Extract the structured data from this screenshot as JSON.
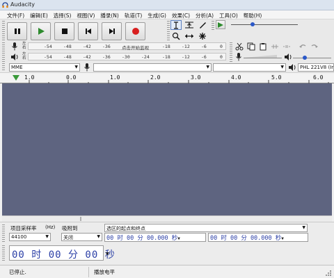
{
  "window": {
    "title": "Audacity"
  },
  "menu": [
    "文件(F)",
    "编辑(E)",
    "选择(S)",
    "视图(V)",
    "播录(N)",
    "轨道(T)",
    "生成(G)",
    "效果(C)",
    "分析(A)",
    "工具(O)",
    "帮助(H)"
  ],
  "transport": {
    "buttons": [
      "pause-icon",
      "play-icon",
      "stop-icon",
      "skip-start-icon",
      "skip-end-icon",
      "record-icon"
    ],
    "colors": {
      "play": "#2e8b2e",
      "record": "#d81f1f"
    }
  },
  "tools": [
    "selection-tool-icon",
    "envelope-tool-icon",
    "draw-tool-icon",
    "zoom-tool-icon",
    "timeshift-tool-icon",
    "multi-tool-icon"
  ],
  "record_meter": {
    "l_label": "左",
    "r_label": "右",
    "ticks": [
      "-54",
      "-48",
      "-42",
      "-36",
      "点击开始监视",
      "-18",
      "-12",
      "-6",
      "0"
    ]
  },
  "play_meter": {
    "l_label": "左",
    "r_label": "右",
    "ticks": [
      "-54",
      "-48",
      "-42",
      "-36",
      "-30",
      "-24",
      "-18",
      "-12",
      "-6",
      "0"
    ]
  },
  "devices": {
    "host": "MME",
    "recording": "",
    "channels": "",
    "playback": "PHL 221V8 (Int"
  },
  "ruler": {
    "labels": [
      "1.0",
      "0.0",
      "1.0",
      "2.0",
      "3.0",
      "4.0",
      "5.0",
      "6.0"
    ]
  },
  "track_area": {
    "background": "#5e6480"
  },
  "selection_toolbar": {
    "rate_label": "项目采样率",
    "rate_unit": "(Hz)",
    "rate_value": "44100",
    "snap_label": "吸附到",
    "snap_value": "关闭",
    "selection_mode": "选区的起点和终点",
    "start_time": "00 时 00 分 00.000 秒",
    "end_time": "00 时 00 分 00.000 秒",
    "audio_position": "00 时 00 分 00 秒"
  },
  "status": {
    "left": "已停止.",
    "right": "播放电平"
  }
}
